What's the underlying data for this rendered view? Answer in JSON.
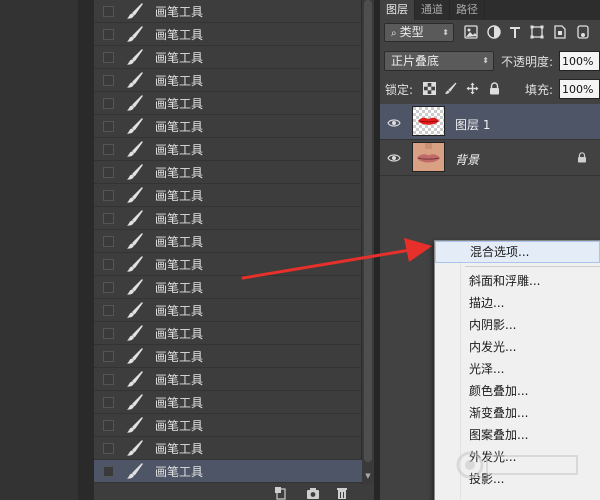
{
  "history": {
    "item_label": "画笔工具",
    "items": [
      {
        "label": "画笔工具"
      },
      {
        "label": "画笔工具"
      },
      {
        "label": "画笔工具"
      },
      {
        "label": "画笔工具"
      },
      {
        "label": "画笔工具"
      },
      {
        "label": "画笔工具"
      },
      {
        "label": "画笔工具"
      },
      {
        "label": "画笔工具"
      },
      {
        "label": "画笔工具"
      },
      {
        "label": "画笔工具"
      },
      {
        "label": "画笔工具"
      },
      {
        "label": "画笔工具"
      },
      {
        "label": "画笔工具"
      },
      {
        "label": "画笔工具"
      },
      {
        "label": "画笔工具"
      },
      {
        "label": "画笔工具"
      },
      {
        "label": "画笔工具"
      },
      {
        "label": "画笔工具"
      },
      {
        "label": "画笔工具"
      },
      {
        "label": "画笔工具"
      },
      {
        "label": "画笔工具"
      }
    ],
    "selected_index": 20
  },
  "layers_panel": {
    "tabs": [
      {
        "label": "图层",
        "active": true
      },
      {
        "label": "通道",
        "active": false
      },
      {
        "label": "路径",
        "active": false
      }
    ],
    "filter_kind": "类型",
    "blend_mode": "正片叠底",
    "opacity_label": "不透明度:",
    "opacity_value": "100%",
    "lock_label": "锁定:",
    "fill_label": "填充:",
    "fill_value": "100%",
    "layers": [
      {
        "name": "图层 1",
        "selected": true,
        "visible": true
      },
      {
        "name": "背景",
        "selected": false,
        "visible": true,
        "locked": true
      }
    ]
  },
  "context_menu": {
    "items": [
      {
        "label": "混合选项...",
        "highlighted": true
      },
      {
        "label": "斜面和浮雕..."
      },
      {
        "label": "描边..."
      },
      {
        "label": "内阴影..."
      },
      {
        "label": "内发光..."
      },
      {
        "label": "光泽..."
      },
      {
        "label": "颜色叠加..."
      },
      {
        "label": "渐变叠加..."
      },
      {
        "label": "图案叠加..."
      },
      {
        "label": "外发光..."
      },
      {
        "label": "投影..."
      }
    ]
  },
  "colors": {
    "selection": "#4d5566",
    "arrow": "#e8302a",
    "menu_highlight": "#e4ecf7"
  }
}
